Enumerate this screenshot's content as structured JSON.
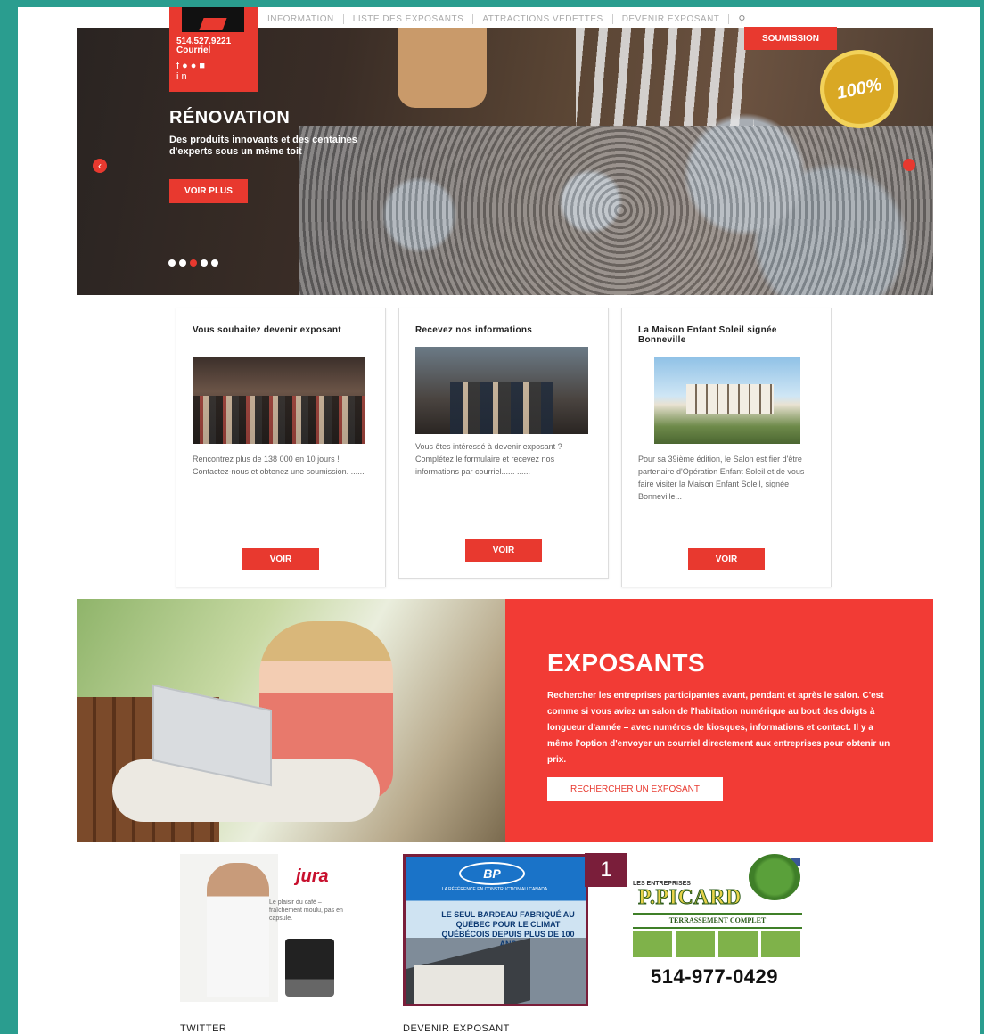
{
  "header": {
    "logo": {
      "phone": "514.527.9221",
      "contact_label": "Courriel",
      "social_icons": [
        "facebook-icon",
        "twitter-icon",
        "pinterest-icon",
        "instagram-icon",
        "linkedin-icon"
      ]
    },
    "nav": [
      "INFORMATION",
      "LISTE DES EXPOSANTS",
      "ATTRACTIONS VEDETTES",
      "DEVENIR EXPOSANT"
    ],
    "search_icon": "search-icon",
    "submission_label": "SOUMISSION"
  },
  "hero": {
    "title": "RÉNOVATION",
    "description": "Des produits innovants et des centaines d'experts sous un même toit",
    "button_label": "VOIR PLUS",
    "badge_text": "100%",
    "active_slide": 3,
    "slide_count": 5
  },
  "cards": [
    {
      "title": "Vous souhaitez devenir exposant",
      "text": "Rencontrez plus de 138 000 en 10 jours ! Contactez-nous et obtenez une soumission. ......",
      "button_label": "VOIR"
    },
    {
      "title": "Recevez nos informations",
      "text": "Vous êtes intéressé à devenir exposant ? Complétez le formulaire et recevez nos informations par courriel...... ......",
      "button_label": "VOIR"
    },
    {
      "title": "La Maison Enfant Soleil signée Bonneville",
      "text": "Pour sa 39ième édition, le Salon est fier d'être partenaire d'Opération Enfant Soleil et de vous faire visiter la Maison Enfant Soleil, signée Bonneville...",
      "button_label": "VOIR"
    }
  ],
  "exposants": {
    "title": "EXPOSANTS",
    "description": "Rechercher les entreprises participantes avant, pendant et après le salon. C'est comme si vous aviez un salon de l'habitation numérique au bout des doigts à longueur d'année – avec numéros de kiosques, informations et contact. Il y a même l'option d'envoyer un courriel directement aux entreprises pour obtenir un prix.",
    "button_label": "RECHERCHER UN EXPOSANT"
  },
  "ads": {
    "jura": {
      "brand": "jura",
      "tagline": "Le plaisir du café – fraîchement moulu, pas en capsule."
    },
    "bp": {
      "logo": "BP",
      "tagline": "LA RÉFÉRENCE EN CONSTRUCTION AU CANADA",
      "headline": "LE SEUL BARDEAU FABRIQUÉ AU QUÉBEC POUR LE CLIMAT QUÉBÉCOIS DEPUIS PLUS DE 100 ANS"
    },
    "badge_number": "1",
    "picard": {
      "small": "LES ENTREPRISES",
      "name": "P.PICARD",
      "sub": "TERRASSEMENT COMPLET",
      "phone": "514-977-0429"
    }
  },
  "footer": {
    "col1": "TWITTER",
    "col2": "DEVENIR EXPOSANT"
  },
  "colors": {
    "accent": "#e8392f",
    "background": "#2a9d8f",
    "ad_highlight": "#7a1e3a"
  }
}
